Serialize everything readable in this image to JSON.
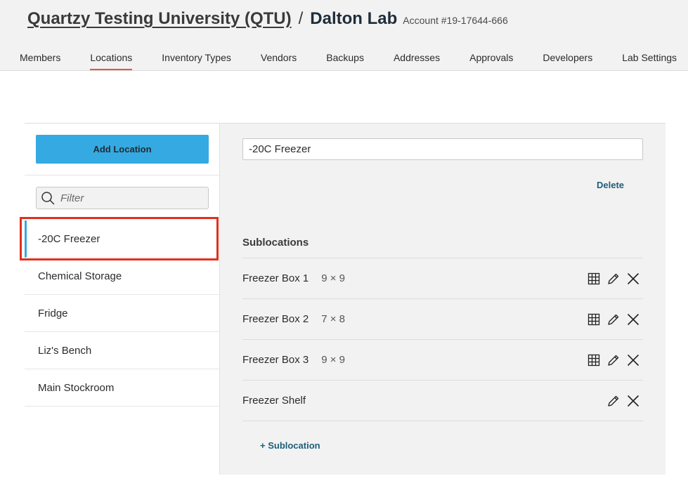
{
  "header": {
    "org_name": "Quartzy Testing University (QTU)",
    "separator": "/",
    "lab_name": "Dalton Lab",
    "account": "Account #19-17644-666"
  },
  "nav": {
    "active": "Locations",
    "tabs": [
      {
        "label": "Members"
      },
      {
        "label": "Locations"
      },
      {
        "label": "Inventory Types"
      },
      {
        "label": "Vendors"
      },
      {
        "label": "Backups"
      },
      {
        "label": "Addresses"
      },
      {
        "label": "Approvals"
      },
      {
        "label": "Developers"
      },
      {
        "label": "Lab Settings"
      }
    ]
  },
  "sidebar": {
    "add_button": "Add Location",
    "filter_placeholder": "Filter",
    "selected": "-20C Freezer",
    "locations": [
      {
        "label": "-20C Freezer"
      },
      {
        "label": "Chemical Storage"
      },
      {
        "label": "Fridge"
      },
      {
        "label": "Liz's Bench"
      },
      {
        "label": "Main Stockroom"
      }
    ]
  },
  "detail": {
    "name_value": "-20C Freezer",
    "delete_label": "Delete",
    "sublocations_heading": "Sublocations",
    "sublocations": [
      {
        "name": "Freezer Box 1",
        "dims": "9 × 9",
        "has_grid": true
      },
      {
        "name": "Freezer Box 2",
        "dims": "7 × 8",
        "has_grid": true
      },
      {
        "name": "Freezer Box 3",
        "dims": "9 × 9",
        "has_grid": true
      },
      {
        "name": "Freezer Shelf",
        "dims": "",
        "has_grid": false
      }
    ],
    "add_sublocation_label": "+ Sublocation"
  },
  "colors": {
    "accent_blue": "#35a9e1",
    "active_tab_underline": "#e8553b",
    "highlight_red": "#e0301e",
    "link_color": "#1e5e7a"
  },
  "icons": {
    "filter": "search-icon",
    "grid": "grid-icon",
    "edit": "pencil-icon",
    "remove": "close-icon"
  }
}
